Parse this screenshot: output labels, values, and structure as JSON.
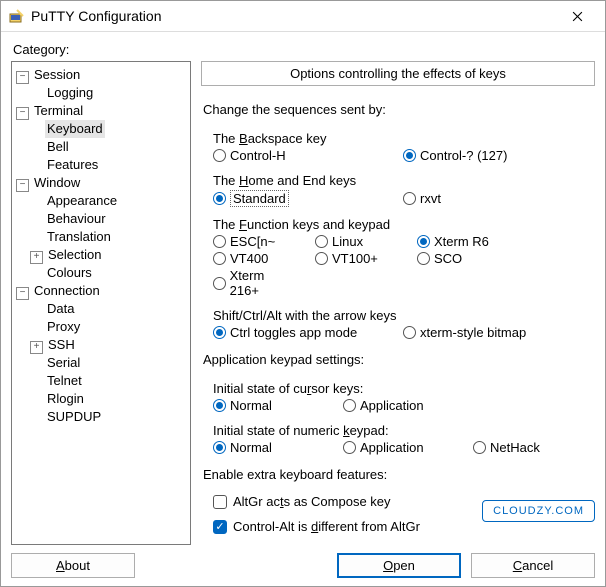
{
  "window": {
    "title": "PuTTY Configuration"
  },
  "category_label": "Category:",
  "tree": {
    "session": "Session",
    "logging": "Logging",
    "terminal": "Terminal",
    "keyboard": "Keyboard",
    "bell": "Bell",
    "features": "Features",
    "window": "Window",
    "appearance": "Appearance",
    "behaviour": "Behaviour",
    "translation": "Translation",
    "selection": "Selection",
    "colours": "Colours",
    "connection": "Connection",
    "data": "Data",
    "proxy": "Proxy",
    "ssh": "SSH",
    "serial": "Serial",
    "telnet": "Telnet",
    "rlogin": "Rlogin",
    "supdup": "SUPDUP"
  },
  "panel_title": "Options controlling the effects of keys",
  "sequences_heading": "Change the sequences sent by:",
  "backspace": {
    "label": "The Backspace key",
    "ctrl_h": "Control-H",
    "ctrl_q": "Control-? (127)"
  },
  "homeend": {
    "label_prefix": "The ",
    "label_underlined": "H",
    "label_suffix": "ome and End keys",
    "standard": "Standard",
    "rxvt": "rxvt"
  },
  "funckeys": {
    "label_prefix": "The ",
    "label_underlined": "F",
    "label_suffix": "unction keys and keypad",
    "esc": "ESC[n~",
    "linux": "Linux",
    "xtermr6": "Xterm R6",
    "vt400": "VT400",
    "vt100p": "VT100+",
    "sco": "SCO",
    "xterm216": "Xterm 216+"
  },
  "arrows": {
    "label": "Shift/Ctrl/Alt with the arrow keys",
    "app": "Ctrl toggles app mode",
    "bitmap": "xterm-style bitmap"
  },
  "appkeypad_heading": "Application keypad settings:",
  "cursor": {
    "label": "Initial state of cursor keys:",
    "normal": "Normal",
    "application": "Application"
  },
  "numeric": {
    "label": "Initial state of numeric keypad:",
    "normal": "Normal",
    "application": "Application",
    "nethack": "NetHack"
  },
  "extra_heading": "Enable extra keyboard features:",
  "altgr_compose": "AltGr acts as Compose key",
  "ctrlalt_diff_prefix": "Control-Alt is ",
  "ctrlalt_diff_u": "d",
  "ctrlalt_diff_suffix": "ifferent from AltGr",
  "buttons": {
    "about_prefix": "",
    "about_u": "A",
    "about_suffix": "bout",
    "open_prefix": "",
    "open_u": "O",
    "open_suffix": "pen",
    "cancel_prefix": "",
    "cancel_u": "C",
    "cancel_suffix": "ancel"
  },
  "watermark": "CLOUDZY.COM"
}
